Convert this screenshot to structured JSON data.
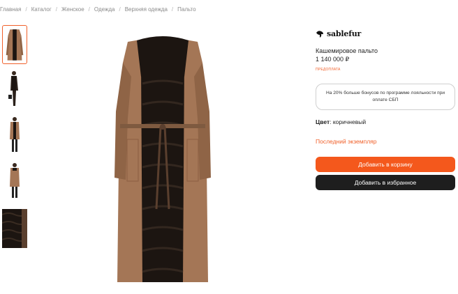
{
  "breadcrumbs": [
    {
      "label": "Главная"
    },
    {
      "label": "Каталог"
    },
    {
      "label": "Женское"
    },
    {
      "label": "Одежда"
    },
    {
      "label": "Верхняя одежда"
    },
    {
      "label": "Пальто"
    }
  ],
  "breadcrumb_separator": "/",
  "brand": {
    "name": "sablefur",
    "icon": "sable-logo-icon"
  },
  "product": {
    "title": "Кашемировое пальто",
    "price": "1 140 000 ₽",
    "prepay_label": "предоплата",
    "bonus_text": "На 20% больше бонусов по программе лояльности при оплате СБП",
    "color_label": "Цвет",
    "color_value": ": коричневый",
    "last_copy": "Последний экземпляр"
  },
  "buttons": {
    "add_to_cart": "Добавить в корзину",
    "add_to_favorites": "Добавить в избранное"
  },
  "thumbnails": [
    {
      "name": "thumb-front",
      "active": true
    },
    {
      "name": "thumb-side",
      "active": false
    },
    {
      "name": "thumb-model-front",
      "active": false
    },
    {
      "name": "thumb-model-back",
      "active": false
    },
    {
      "name": "thumb-fur-detail",
      "active": false
    }
  ],
  "colors": {
    "accent": "#f4581c",
    "dark_button": "#1e1e1e",
    "coat_brown": "#a47656",
    "fur_dark": "#1c1511"
  }
}
